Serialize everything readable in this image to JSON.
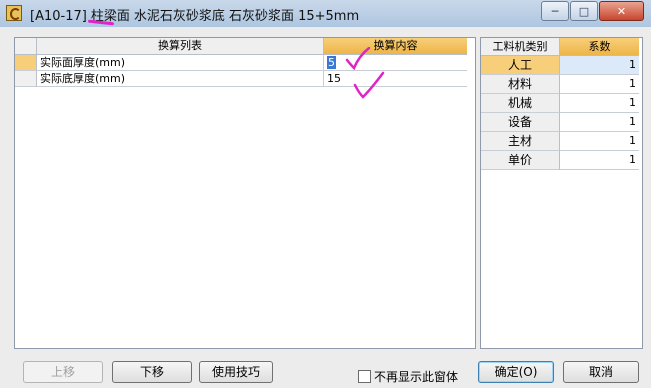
{
  "window": {
    "code": "[A10-17]",
    "part1": "柱梁面",
    "part2": "水泥石灰砂浆底 石灰砂浆面 15+5mm",
    "minimize": "─",
    "maximize": "□",
    "close": "✕"
  },
  "left_table": {
    "headers": [
      "换算列表",
      "换算内容"
    ],
    "rows": [
      {
        "label": "实际面厚度(mm)",
        "value": "5"
      },
      {
        "label": "实际底厚度(mm)",
        "value": "15"
      }
    ]
  },
  "right_table": {
    "headers": [
      "工料机类别",
      "系数"
    ],
    "rows": [
      {
        "category": "人工",
        "factor": "1"
      },
      {
        "category": "材料",
        "factor": "1"
      },
      {
        "category": "机械",
        "factor": "1"
      },
      {
        "category": "设备",
        "factor": "1"
      },
      {
        "category": "主材",
        "factor": "1"
      },
      {
        "category": "单价",
        "factor": "1"
      }
    ]
  },
  "buttons": {
    "up": "上移",
    "down": "下移",
    "tips": "使用技巧",
    "ok": "确定(O)",
    "cancel": "取消"
  },
  "checkbox": {
    "label": "不再显示此窗体",
    "checked": false
  },
  "colors": {
    "header_accent": "#eeb547",
    "annotation": "#e023c8"
  },
  "icons": {
    "app": "app-icon"
  }
}
